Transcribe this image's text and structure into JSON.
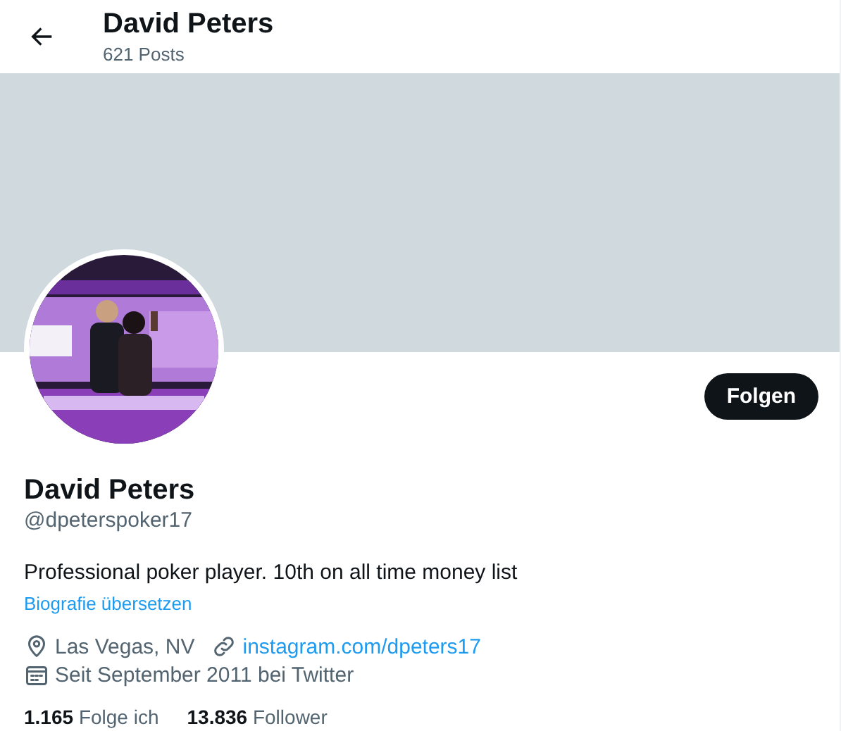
{
  "header": {
    "title": "David Peters",
    "post_count": "621 Posts"
  },
  "profile": {
    "follow_button": "Folgen",
    "name": "David Peters",
    "handle": "@dpeterspoker17",
    "bio": "Professional poker player. 10th on all time money list",
    "translate_link": "Biografie übersetzen",
    "details": [
      {
        "kind": "location",
        "text": "Las Vegas, NV"
      },
      {
        "kind": "link",
        "text": "instagram.com/dpeters17"
      },
      {
        "kind": "joined",
        "text": "Seit September 2011 bei Twitter"
      }
    ],
    "stats": [
      {
        "count": "1.165",
        "label": "Folge ich"
      },
      {
        "count": "13.836",
        "label": "Follower"
      }
    ]
  }
}
